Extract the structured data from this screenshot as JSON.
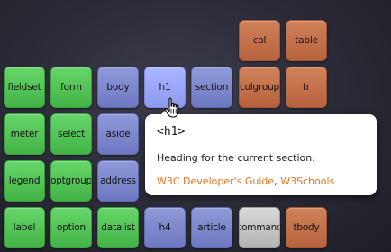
{
  "tiles": [
    {
      "label": "col",
      "color": "orange"
    },
    {
      "label": "table",
      "color": "orange"
    },
    {
      "label": "fieldset",
      "color": "green"
    },
    {
      "label": "form",
      "color": "green"
    },
    {
      "label": "body",
      "color": "purple"
    },
    {
      "label": "h1",
      "color": "purple-hover"
    },
    {
      "label": "section",
      "color": "purple"
    },
    {
      "label": "colgroup",
      "color": "orange"
    },
    {
      "label": "tr",
      "color": "orange"
    },
    {
      "label": "meter",
      "color": "green"
    },
    {
      "label": "select",
      "color": "green"
    },
    {
      "label": "aside",
      "color": "purple"
    },
    {
      "label": "legend",
      "color": "green"
    },
    {
      "label": "optgroup",
      "color": "green"
    },
    {
      "label": "address",
      "color": "purple"
    },
    {
      "label": "label",
      "color": "green"
    },
    {
      "label": "option",
      "color": "green"
    },
    {
      "label": "datalist",
      "color": "green"
    },
    {
      "label": "h4",
      "color": "purple"
    },
    {
      "label": "article",
      "color": "purple"
    },
    {
      "label": "command",
      "color": "gray"
    },
    {
      "label": "tbody",
      "color": "orange"
    }
  ],
  "tooltip": {
    "title": "<h1>",
    "description": "Heading for the current section.",
    "link1": "W3C Developer's Guide",
    "separator": ", ",
    "link2": "W3Schools"
  },
  "colors": {
    "green": "#4fc254",
    "purple": "#7e88cc",
    "purple_hover": "#9ca8f6",
    "orange": "#c4704c",
    "gray": "#c4c4c4",
    "link": "#e3741e"
  },
  "cursor_icon": "hand-pointer-icon"
}
